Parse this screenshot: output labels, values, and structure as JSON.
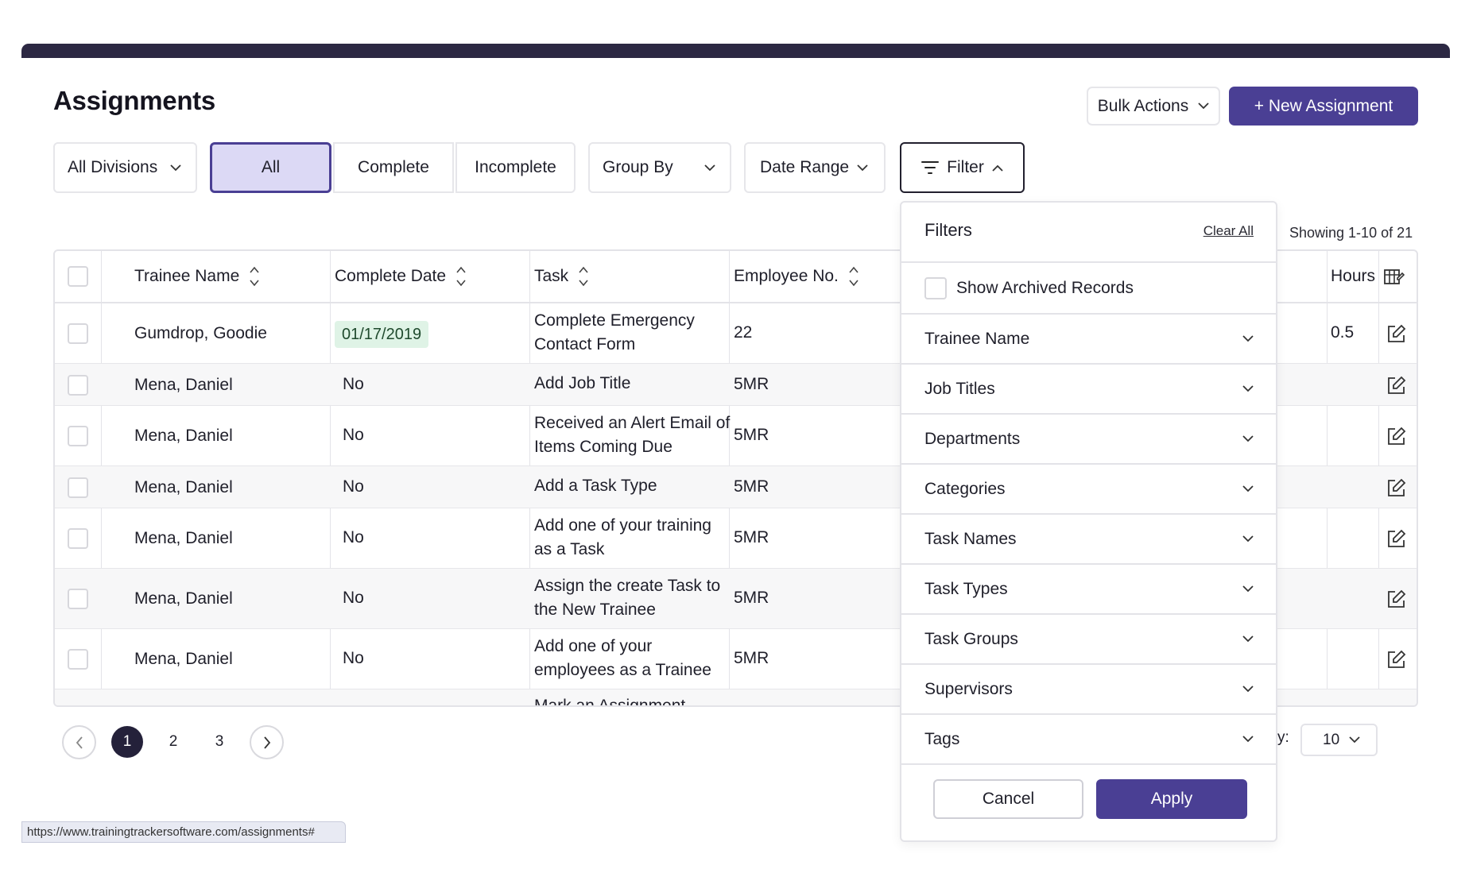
{
  "page": {
    "title": "Assignments"
  },
  "actions": {
    "bulk_label": "Bulk Actions",
    "new_label": "+ New Assignment"
  },
  "toolbar": {
    "divisions": "All Divisions",
    "status_tabs": [
      "All",
      "Complete",
      "Incomplete"
    ],
    "active_tab": "All",
    "group_by": "Group By",
    "date_range": "Date Range",
    "filter": "Filter"
  },
  "showing": "Showing 1-10 of 21",
  "table": {
    "columns": [
      "Trainee Name",
      "Complete Date",
      "Task",
      "Employee No.",
      "Hours"
    ],
    "rows": [
      {
        "trainee": "Gumdrop, Goodie",
        "complete_date": "01/17/2019",
        "task_line1": "Complete Emergency",
        "task_line2": "Contact Form",
        "employee_no": "22",
        "hours": "0.5"
      },
      {
        "trainee": "Mena, Daniel",
        "complete_date": "No",
        "task_line1": "Add Job Title",
        "task_line2": "",
        "employee_no": "5MR",
        "hours": ""
      },
      {
        "trainee": "Mena, Daniel",
        "complete_date": "No",
        "task_line1": "Received an Alert Email of",
        "task_line2": "Items Coming Due",
        "employee_no": "5MR",
        "hours": ""
      },
      {
        "trainee": "Mena, Daniel",
        "complete_date": "No",
        "task_line1": "Add a Task Type",
        "task_line2": "",
        "employee_no": "5MR",
        "hours": ""
      },
      {
        "trainee": "Mena, Daniel",
        "complete_date": "No",
        "task_line1": "Add one of your training",
        "task_line2": "as a Task",
        "employee_no": "5MR",
        "hours": ""
      },
      {
        "trainee": "Mena, Daniel",
        "complete_date": "No",
        "task_line1": "Assign the create Task to",
        "task_line2": "the New Trainee",
        "employee_no": "5MR",
        "hours": ""
      },
      {
        "trainee": "Mena, Daniel",
        "complete_date": "No",
        "task_line1": "Add one of your",
        "task_line2": "employees as a Trainee",
        "employee_no": "5MR",
        "hours": ""
      }
    ],
    "partial_row_task": "Mark an Assignment"
  },
  "pagination": {
    "pages": [
      "1",
      "2",
      "3"
    ],
    "current": "1"
  },
  "per_page": {
    "label": "y:",
    "value": "10"
  },
  "status_url": "https://www.trainingtrackersoftware.com/assignments#",
  "filter_panel": {
    "title": "Filters",
    "clear_all": "Clear All",
    "show_archived": "Show Archived Records",
    "sections": [
      "Trainee Name",
      "Job Titles",
      "Departments",
      "Categories",
      "Task Names",
      "Task Types",
      "Task Groups",
      "Supervisors",
      "Tags"
    ],
    "cancel": "Cancel",
    "apply": "Apply"
  },
  "colors": {
    "accent": "#4a3f94",
    "header_bar": "#2c2843",
    "active_tab_bg": "#dcd9f5",
    "date_chip_bg": "#dff3e6"
  }
}
